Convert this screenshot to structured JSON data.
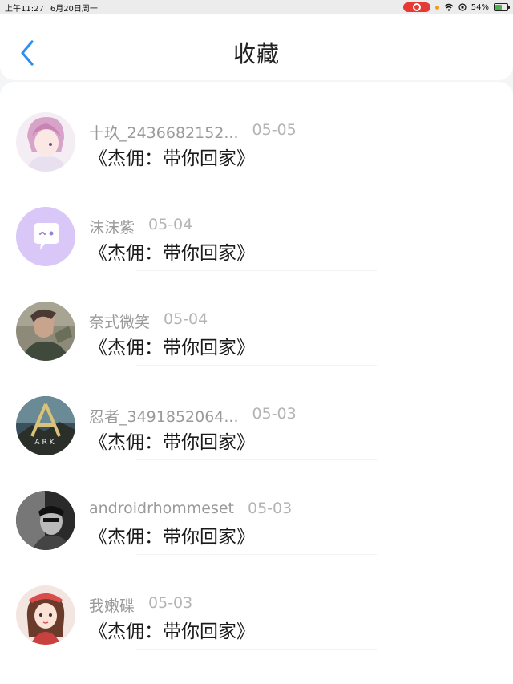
{
  "status_bar": {
    "time": "上午11:27",
    "date": "6月20日周一",
    "battery": "54%",
    "battery_level": 0.54
  },
  "header": {
    "title": "收藏",
    "back_icon": "chevron-left-icon",
    "accent_color": "#2d8ff0"
  },
  "items": [
    {
      "name": "十玖_2436682152...",
      "date": "05-05",
      "text": "《杰佣：带你回家》"
    },
    {
      "name": "沫沫紫",
      "date": "05-04",
      "text": "《杰佣：带你回家》"
    },
    {
      "name": "奈式微笑",
      "date": "05-04",
      "text": "《杰佣：带你回家》"
    },
    {
      "name": "忍者_3491852064...",
      "date": "05-03",
      "text": "《杰佣：带你回家》"
    },
    {
      "name": "androidrhommeset",
      "date": "05-03",
      "text": "《杰佣：带你回家》"
    },
    {
      "name": "我嫩碟",
      "date": "05-03",
      "text": "《杰佣：带你回家》"
    }
  ]
}
